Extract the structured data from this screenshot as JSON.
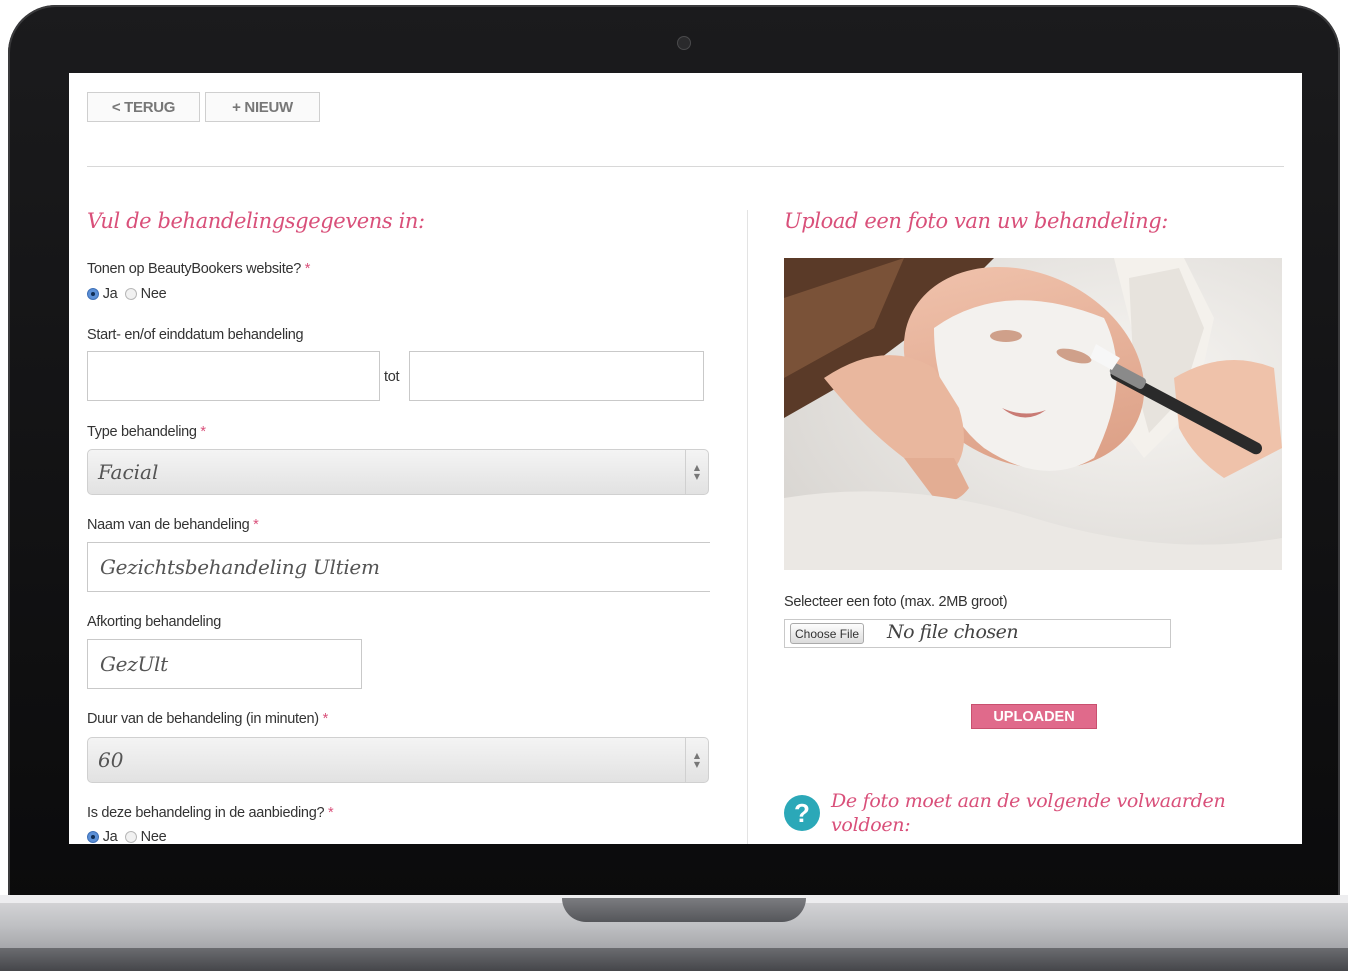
{
  "nav": {
    "back_label": "< TERUG",
    "new_label": "+ NIEUW"
  },
  "form": {
    "heading": "Vul de behandelingsgegevens in:",
    "show_label": "Tonen op BeautyBookers website?",
    "required_mark": "*",
    "yes_label": "Ja",
    "no_label": "Nee",
    "show_selected": "Ja",
    "date_label": "Start- en/of einddatum behandeling",
    "date_start": "",
    "date_to": "tot",
    "date_end": "",
    "type_label": "Type behandeling",
    "type_value": "Facial",
    "name_label": "Naam van de behandeling",
    "name_value": "Gezichtsbehandeling Ultiem",
    "abbr_label": "Afkorting behandeling",
    "abbr_value": "GezUlt",
    "duration_label": "Duur van de behandeling (in minuten)",
    "duration_value": "60",
    "offer_label": "Is deze behandeling in de aanbieding?"
  },
  "upload": {
    "heading": "Upload een foto van uw behandeling:",
    "select_label": "Selecteer een foto (max. 2MB groot)",
    "choose_file": "Choose File",
    "no_file": "No file chosen",
    "button": "UPLOADEN",
    "help_text": "De foto moet aan de volgende volwaarden voldoen:"
  },
  "colors": {
    "accent": "#d9507a",
    "button": "#e06a8b",
    "help_icon": "#2ba8b8"
  }
}
